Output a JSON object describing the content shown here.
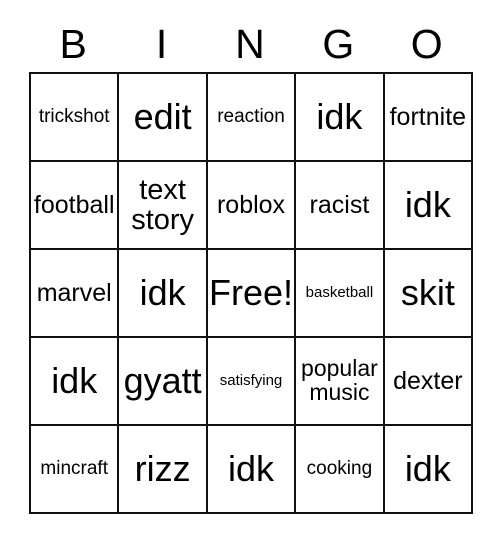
{
  "card": {
    "title": "BINGO",
    "header_letters": [
      "B",
      "I",
      "N",
      "G",
      "O"
    ],
    "free_space_label": "Free!",
    "rows": [
      [
        {
          "text": "trickshot",
          "size": "sm"
        },
        {
          "text": "edit",
          "size": "xl"
        },
        {
          "text": "reaction",
          "size": "sm"
        },
        {
          "text": "idk",
          "size": "xl"
        },
        {
          "text": "fortnite",
          "size": "md"
        }
      ],
      [
        {
          "text": "football",
          "size": "md"
        },
        {
          "text": "text story",
          "size": "two-lg"
        },
        {
          "text": "roblox",
          "size": "md"
        },
        {
          "text": "racist",
          "size": "md"
        },
        {
          "text": "idk",
          "size": "xl"
        }
      ],
      [
        {
          "text": "marvel",
          "size": "md"
        },
        {
          "text": "idk",
          "size": "xl"
        },
        {
          "text": "Free!",
          "size": "xl"
        },
        {
          "text": "basketball",
          "size": "xs"
        },
        {
          "text": "skit",
          "size": "xl"
        }
      ],
      [
        {
          "text": "idk",
          "size": "xl"
        },
        {
          "text": "gyatt",
          "size": "xl"
        },
        {
          "text": "satisfying",
          "size": "xs"
        },
        {
          "text": "popular music",
          "size": "two-md"
        },
        {
          "text": "dexter",
          "size": "md"
        }
      ],
      [
        {
          "text": "mincraft",
          "size": "sm"
        },
        {
          "text": "rizz",
          "size": "xl"
        },
        {
          "text": "idk",
          "size": "xl"
        },
        {
          "text": "cooking",
          "size": "sm"
        },
        {
          "text": "idk",
          "size": "xl"
        }
      ]
    ],
    "colors": {
      "background": "#ffffff",
      "grid_line": "#111111",
      "text": "#000000"
    }
  }
}
